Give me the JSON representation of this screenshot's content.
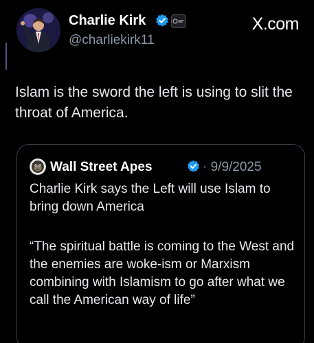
{
  "brand": {
    "label": "X.com"
  },
  "author": {
    "display_name": "Charlie Kirk",
    "handle": "@charliekirk11",
    "avatar_icon": "person-portrait-avatar",
    "verified_icon": "verified-checkmark-icon",
    "affiliate_badge": "affiliate-org-badge-icon",
    "verified_color": "#1d9bf0"
  },
  "tweet": {
    "text": "Islam is the sword the left is using to slit the throat of America."
  },
  "quote": {
    "author_name": "Wall Street Apes",
    "date": "· 9/9/2025",
    "avatar_icon": "ape-avatar-icon",
    "verified_icon": "verified-checkmark-icon",
    "headline": "Charlie Kirk says the Left will use Islam to bring down America",
    "body": "“The spiritual battle is coming to the West and the enemies are woke-ism or Marxism combining with Islamism to go after what we call the American way of life”"
  },
  "theme": {
    "background": "#000000",
    "text_primary": "#e7e9ea",
    "text_secondary": "#8b98a5",
    "border": "#3b3f44"
  }
}
